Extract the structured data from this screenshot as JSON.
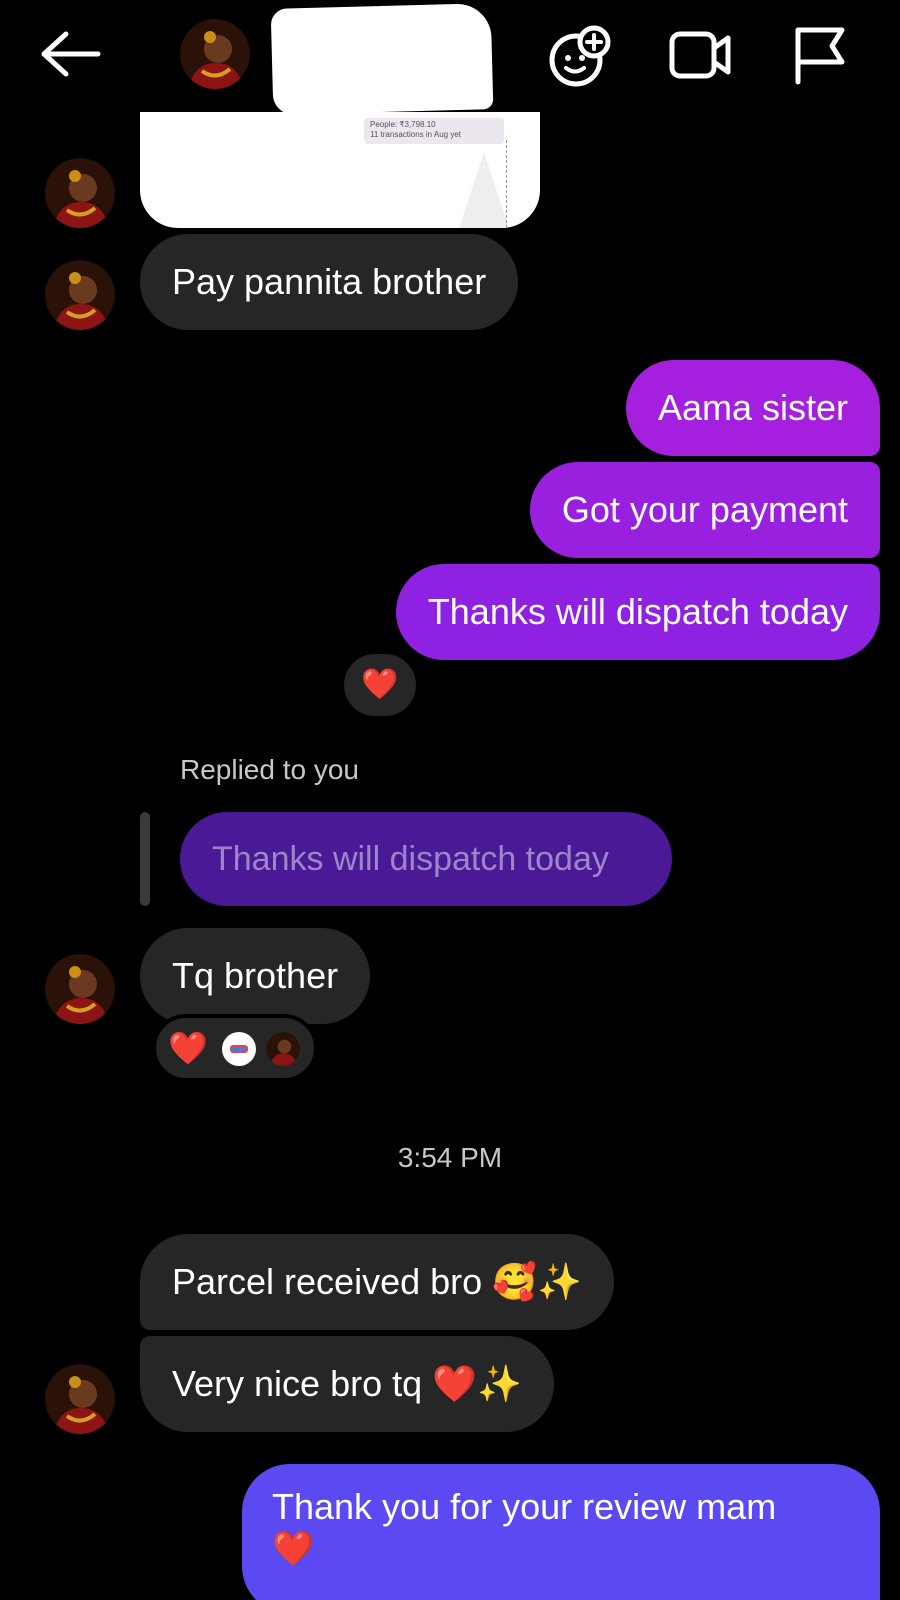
{
  "header": {
    "back_icon": "arrow-left-icon",
    "call_icon": "sticker-add-icon",
    "video_icon": "video-camera-icon",
    "report_icon": "flag-icon"
  },
  "shared_card": {
    "line1": "People: ₹3,798.10",
    "line2": "11 transactions in Aug yet"
  },
  "messages": {
    "m1": "Pay pannita brother",
    "m2": "Aama sister",
    "m3": "Got your payment",
    "m4": "Thanks will dispatch today",
    "m4_reaction": "❤️",
    "replied_label": "Replied to you",
    "replied_quote": "Thanks will dispatch today",
    "m5": "Tq brother",
    "m5_reaction_heart": "❤️",
    "timestamp": "3:54 PM",
    "m6": "Parcel received bro 🥰✨",
    "m7": "Very nice bro tq ❤️✨",
    "m8_line1": "Thank you for your review mam",
    "m8_line2": "❤️"
  },
  "colors": {
    "incoming": "#262626",
    "outgoing": "#a41fde",
    "outgoing_latest": "#5b4af2",
    "reply_quote": "#4a1a96"
  }
}
